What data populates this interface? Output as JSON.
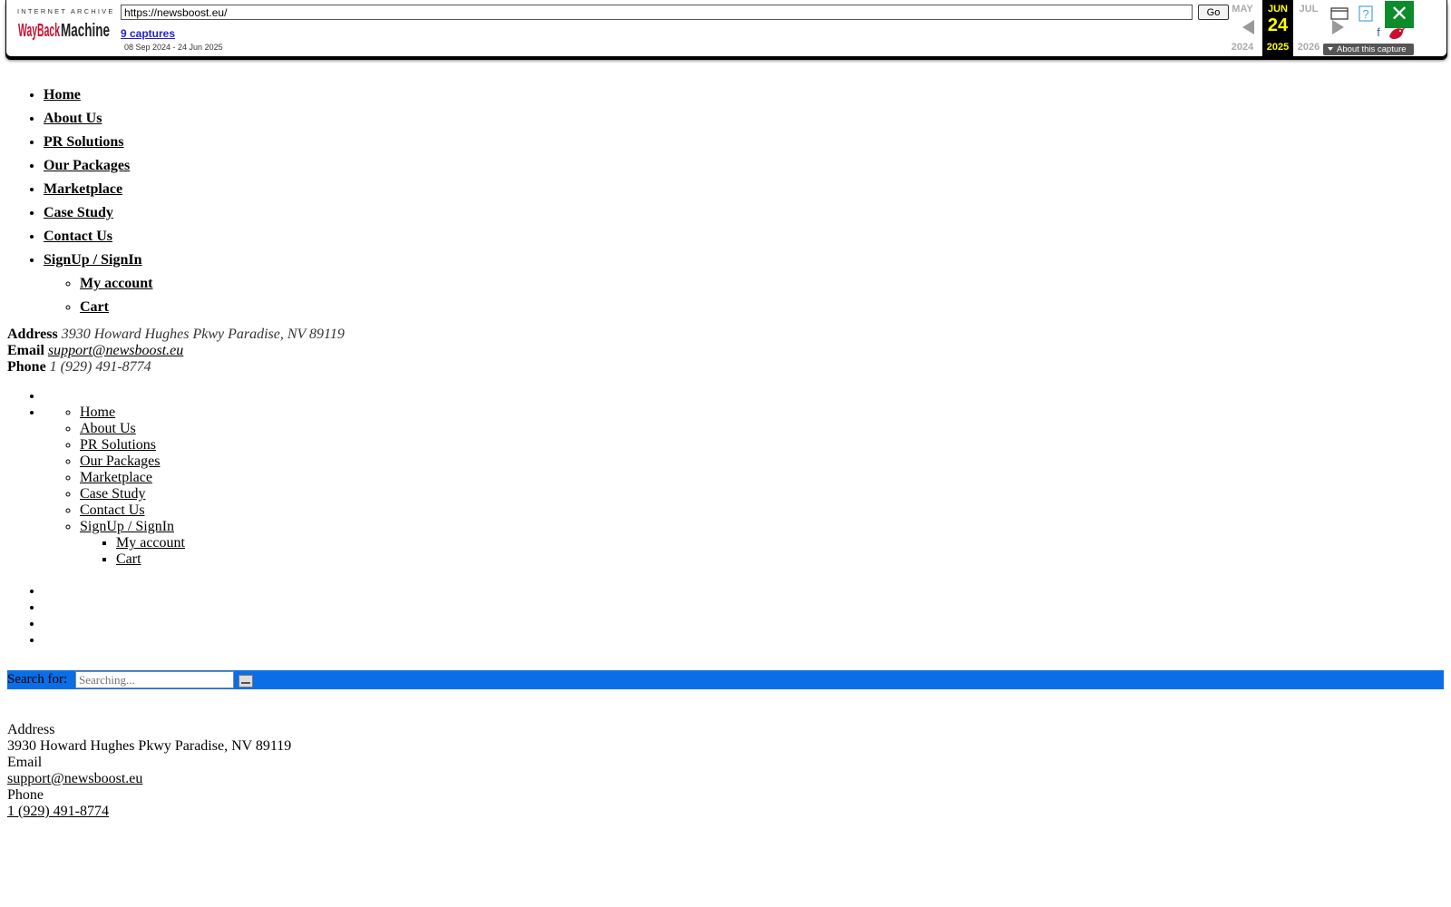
{
  "wayback": {
    "logo_top": "INTERNET ARCHIVE",
    "logo_main": "WayBackMachine",
    "url": "https://newsboost.eu/",
    "go_label": "Go",
    "captures_label": "9 captures",
    "date_range": "08 Sep 2024 - 24 Jun 2025",
    "prev": {
      "month": "MAY",
      "year": "2024"
    },
    "current": {
      "month": "JUN",
      "day": "24",
      "year": "2025"
    },
    "next": {
      "month": "JUL",
      "year": "2026"
    },
    "about_label": "About this capture",
    "colors": {
      "current_bg": "#000000",
      "current_text": "#ffff00",
      "close_bg": "#0c8c2a",
      "logo_red": "#c8102e"
    }
  },
  "nav": {
    "items": [
      "Home",
      "About Us",
      "PR Solutions",
      "Our Packages",
      "Marketplace",
      "Case Study",
      "Contact Us",
      "SignUp / SignIn"
    ],
    "sub_items": [
      "My account",
      "Cart"
    ]
  },
  "top_contact": {
    "address_label": "Address",
    "address": "3930 Howard Hughes Pkwy Paradise, NV 89119",
    "email_label": "Email",
    "email": "support@newsboost.eu",
    "phone_label": "Phone",
    "phone": "1 (929) 491-8774"
  },
  "mobile_nav": {
    "items": [
      "Home",
      "About Us",
      "PR Solutions",
      "Our Packages",
      "Marketplace",
      "Case Study",
      "Contact Us",
      "SignUp / SignIn"
    ],
    "sub_items": [
      "My account",
      "Cart"
    ]
  },
  "search": {
    "label": "Search for:",
    "placeholder": "Searching...",
    "bar_color": "#0a6ee6"
  },
  "footer_contact": {
    "address_label": "Address",
    "address": "3930 Howard Hughes Pkwy Paradise, NV 89119",
    "email_label": "Email",
    "email": "support@newsboost.eu",
    "phone_label": "Phone",
    "phone": "1 (929) 491-8774"
  }
}
